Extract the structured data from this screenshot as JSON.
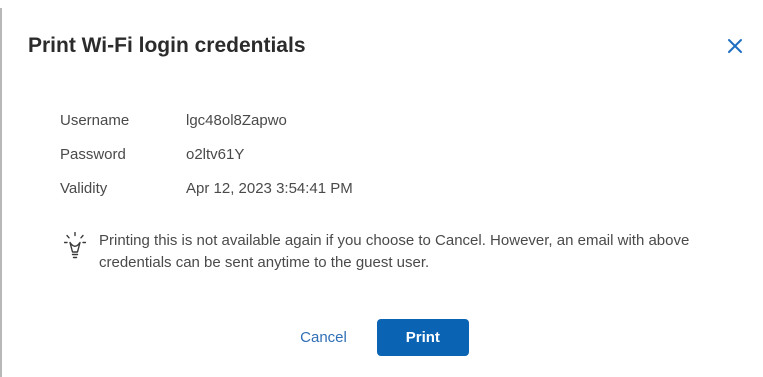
{
  "dialog": {
    "title": "Print Wi-Fi login credentials",
    "close_icon": "close-icon"
  },
  "credentials": [
    {
      "label": "Username",
      "value": "lgc48ol8Zapwo"
    },
    {
      "label": "Password",
      "value": "o2ltv61Y"
    },
    {
      "label": "Validity",
      "value": "Apr 12, 2023 3:54:41 PM"
    }
  ],
  "notice": {
    "icon": "lightbulb-icon",
    "text": "Printing this is not available again if you choose to Cancel. However, an email with above credentials can be sent anytime to the guest user."
  },
  "actions": {
    "cancel_label": "Cancel",
    "print_label": "Print"
  },
  "colors": {
    "primary": "#0a64b3",
    "link": "#2f6fb5",
    "close": "#1f6fc2",
    "text": "#4a4a4a",
    "title": "#2b2b2b"
  }
}
